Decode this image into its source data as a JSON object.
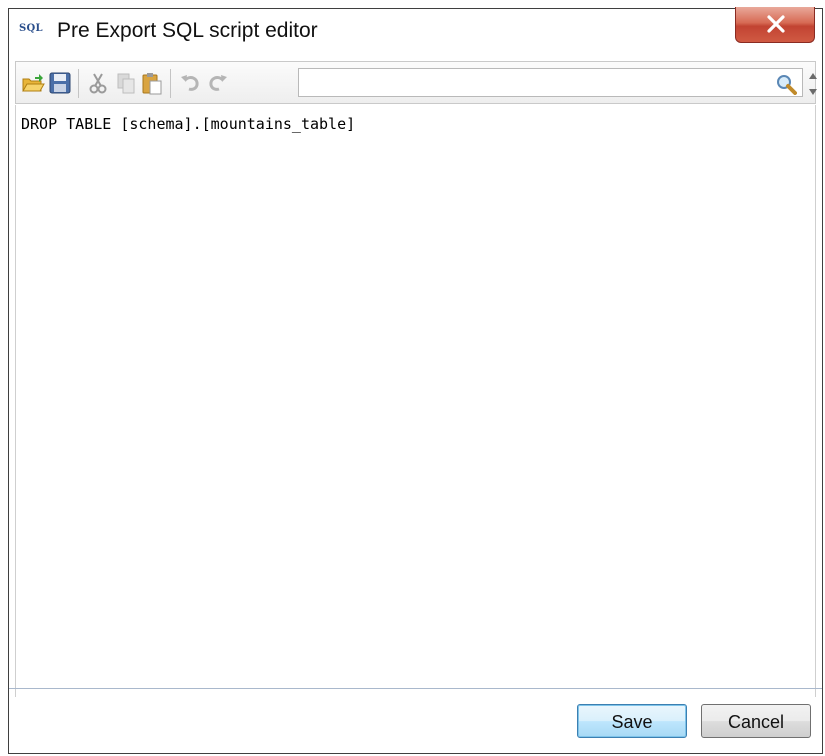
{
  "window": {
    "title": "Pre Export SQL script editor",
    "title_icon_text": "SQL"
  },
  "toolbar": {
    "buttons": [
      "open-icon",
      "save-icon",
      "cut-icon",
      "copy-icon",
      "paste-icon",
      "undo-icon",
      "redo-icon"
    ],
    "search": {
      "value": "",
      "placeholder": ""
    }
  },
  "editor": {
    "line_1": "DROP TABLE [schema].[mountains_table]"
  },
  "footer": {
    "save_label": "Save",
    "cancel_label": "Cancel"
  },
  "colors": {
    "close_button": "#c9503c",
    "primary_button_border": "#3c7fb1"
  }
}
